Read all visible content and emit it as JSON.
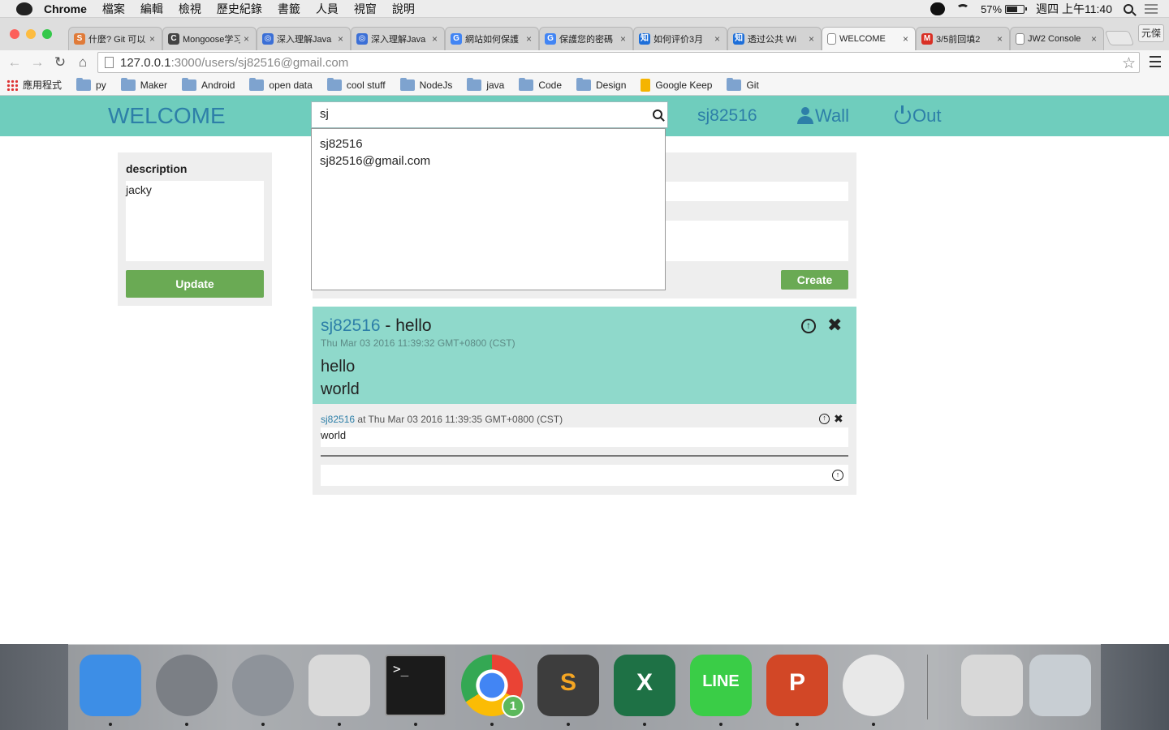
{
  "menubar": {
    "app": "Chrome",
    "items": [
      "檔案",
      "編輯",
      "檢視",
      "歷史紀錄",
      "書籤",
      "人員",
      "視窗",
      "說明"
    ],
    "battery": "57%",
    "clock": "週四 上午11:40"
  },
  "tabs": [
    {
      "title": "什麼? Git 可以",
      "icon": "s9-icon",
      "color": "#e07b39",
      "glyph": "S"
    },
    {
      "title": "Mongoose学习",
      "icon": "mongoose-icon",
      "color": "#444444",
      "glyph": "C"
    },
    {
      "title": "深入理解Java",
      "icon": "globe-icon",
      "color": "#3b6fd6",
      "glyph": "◎"
    },
    {
      "title": "深入理解Java",
      "icon": "globe-icon",
      "color": "#3b6fd6",
      "glyph": "◎"
    },
    {
      "title": "網站如何保護",
      "icon": "google-icon",
      "color": "#4285f4",
      "glyph": "G"
    },
    {
      "title": "保護您的密碼",
      "icon": "google-icon",
      "color": "#4285f4",
      "glyph": "G"
    },
    {
      "title": "如何评价3月",
      "icon": "zhihu-icon",
      "color": "#1e6fd9",
      "glyph": "知"
    },
    {
      "title": "透过公共 Wi",
      "icon": "zhihu-icon",
      "color": "#1e6fd9",
      "glyph": "知"
    },
    {
      "title": "WELCOME",
      "icon": "page-icon",
      "color": "#ffffff",
      "glyph": "",
      "active": true
    },
    {
      "title": "3/5前回填2",
      "icon": "gmail-icon",
      "color": "#d93025",
      "glyph": "M"
    },
    {
      "title": "JW2 Console",
      "icon": "page-icon",
      "color": "#ffffff",
      "glyph": ""
    }
  ],
  "profile_label": "元傑",
  "address": {
    "host": "127.0.0.1",
    "rest": ":3000/users/sj82516@gmail.com"
  },
  "bookmarks": [
    "應用程式",
    "py",
    "Maker",
    "Android",
    "open data",
    "cool stuff",
    "NodeJs",
    "java",
    "Code",
    "Design",
    "Google Keep",
    "Git"
  ],
  "app": {
    "brand": "WELCOME",
    "search_value": "sj",
    "suggestions": [
      "sj82516",
      "sj82516@gmail.com"
    ],
    "nav_user": "sj82516",
    "nav_wall": "Wall",
    "nav_out": "Out"
  },
  "profile_panel": {
    "label": "description",
    "value": "jacky",
    "update_label": "Update"
  },
  "create_panel": {
    "create_label": "Create"
  },
  "post": {
    "author": "sj82516",
    "title": "hello",
    "date": "Thu Mar 03 2016 11:39:32 GMT+0800 (CST)",
    "lines": [
      "hello",
      "world"
    ]
  },
  "comment": {
    "author": "sj82516",
    "meta": "at Thu Mar 03 2016 11:39:35 GMT+0800 (CST)",
    "text": "world"
  },
  "dock": [
    {
      "name": "finder-icon",
      "color": "#3d8ee6"
    },
    {
      "name": "system-preferences-icon",
      "color": "#7b7f85"
    },
    {
      "name": "launchpad-icon",
      "color": "#8e939a"
    },
    {
      "name": "screenshot-tool-icon",
      "color": "#d9d9d9"
    },
    {
      "name": "terminal-icon",
      "color": "#1b1b1b"
    },
    {
      "name": "chrome-icon",
      "color": "#34a853"
    },
    {
      "name": "sublime-text-icon",
      "color": "#3d3d3d"
    },
    {
      "name": "excel-icon",
      "color": "#1e7145"
    },
    {
      "name": "line-icon",
      "color": "#3acd47"
    },
    {
      "name": "powerpoint-icon",
      "color": "#d24726"
    },
    {
      "name": "dictionary-icon",
      "color": "#e8e8e8"
    },
    {
      "name": "disk-utility-icon",
      "color": "#d8d8d8"
    },
    {
      "name": "trash-icon",
      "color": "#c8ced3"
    }
  ],
  "chrome_badge": "1"
}
